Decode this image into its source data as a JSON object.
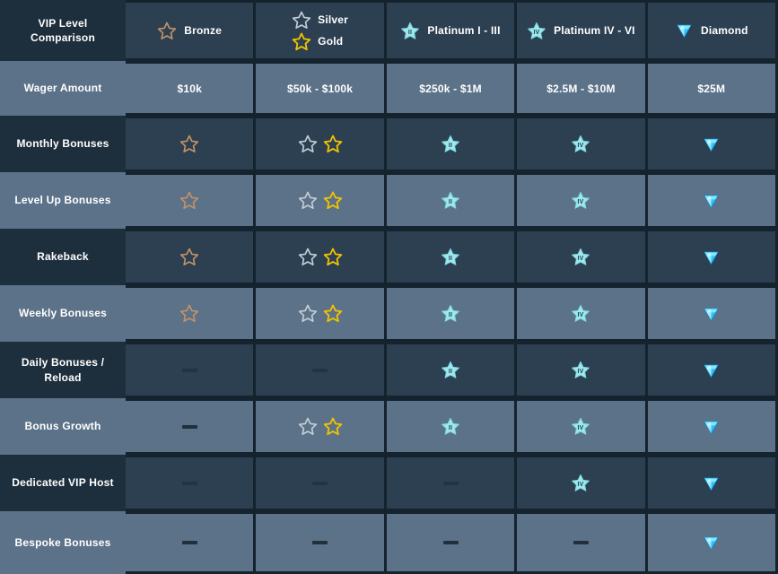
{
  "table": {
    "title": "VIP Level Comparison",
    "columns": [
      {
        "key": "bronze",
        "label": "Bronze",
        "icons": [
          "bronze-star"
        ],
        "wager": "$10k"
      },
      {
        "key": "silver_gold",
        "label": "Silver",
        "label2": "Gold",
        "icons": [
          "silver-star",
          "gold-star"
        ],
        "wager": "$50k - $100k"
      },
      {
        "key": "platinum_1_3",
        "label": "Platinum I - III",
        "icons": [
          "platinum-star-ii"
        ],
        "wager": "$250k - $1M"
      },
      {
        "key": "platinum_4_6",
        "label": "Platinum IV - VI",
        "icons": [
          "platinum-star-iv"
        ],
        "wager": "$2.5M - $10M"
      },
      {
        "key": "diamond",
        "label": "Diamond",
        "icons": [
          "diamond-gem"
        ],
        "wager": "$25M"
      }
    ],
    "wager_row_label": "Wager Amount",
    "rows": [
      {
        "label": "Monthly Bonuses",
        "tone": "dark",
        "cells": [
          "bronze-star",
          "silver-gold-pair",
          "platinum-star-ii",
          "platinum-star-iv",
          "diamond-gem"
        ]
      },
      {
        "label": "Level Up Bonuses",
        "tone": "light",
        "cells": [
          "bronze-star",
          "silver-gold-pair",
          "platinum-star-ii",
          "platinum-star-iv",
          "diamond-gem"
        ]
      },
      {
        "label": "Rakeback",
        "tone": "dark",
        "cells": [
          "bronze-star",
          "silver-gold-pair",
          "platinum-star-ii",
          "platinum-star-iv",
          "diamond-gem"
        ]
      },
      {
        "label": "Weekly Bonuses",
        "tone": "light",
        "cells": [
          "bronze-star",
          "silver-gold-pair",
          "platinum-star-ii",
          "platinum-star-iv",
          "diamond-gem"
        ]
      },
      {
        "label": "Daily Bonuses / Reload",
        "tone": "dark",
        "cells": [
          "dash",
          "dash",
          "platinum-star-ii",
          "platinum-star-iv",
          "diamond-gem"
        ]
      },
      {
        "label": "Bonus Growth",
        "tone": "light",
        "cells": [
          "dash",
          "silver-gold-pair",
          "platinum-star-ii",
          "platinum-star-iv",
          "diamond-gem"
        ]
      },
      {
        "label": "Dedicated VIP Host",
        "tone": "dark",
        "cells": [
          "dash",
          "dash",
          "dash",
          "platinum-star-iv",
          "diamond-gem"
        ]
      },
      {
        "label": "Bespoke Bonuses",
        "tone": "light",
        "cells": [
          "dash",
          "dash",
          "dash",
          "dash",
          "diamond-gem"
        ]
      }
    ]
  },
  "colors": {
    "page_background": "#14232e",
    "cell_dark": "#2c4052",
    "cell_light": "#5c7289",
    "label_dark": "#1d2f3d",
    "text": "#ffffff",
    "bronze": "#c39266",
    "silver": "#c3ced6",
    "gold": "#f2c200",
    "platinum": "#9fe8ee",
    "diamond": "#29c5ff",
    "dash": "#24333f"
  },
  "icon_labels": {
    "bronze-star": "bronze-star-icon",
    "silver-star": "silver-star-icon",
    "gold-star": "gold-star-icon",
    "platinum-star-ii": "platinum-star-ii-icon",
    "platinum-star-iv": "platinum-star-iv-icon",
    "diamond-gem": "diamond-gem-icon",
    "dash": "not-available-dash"
  }
}
